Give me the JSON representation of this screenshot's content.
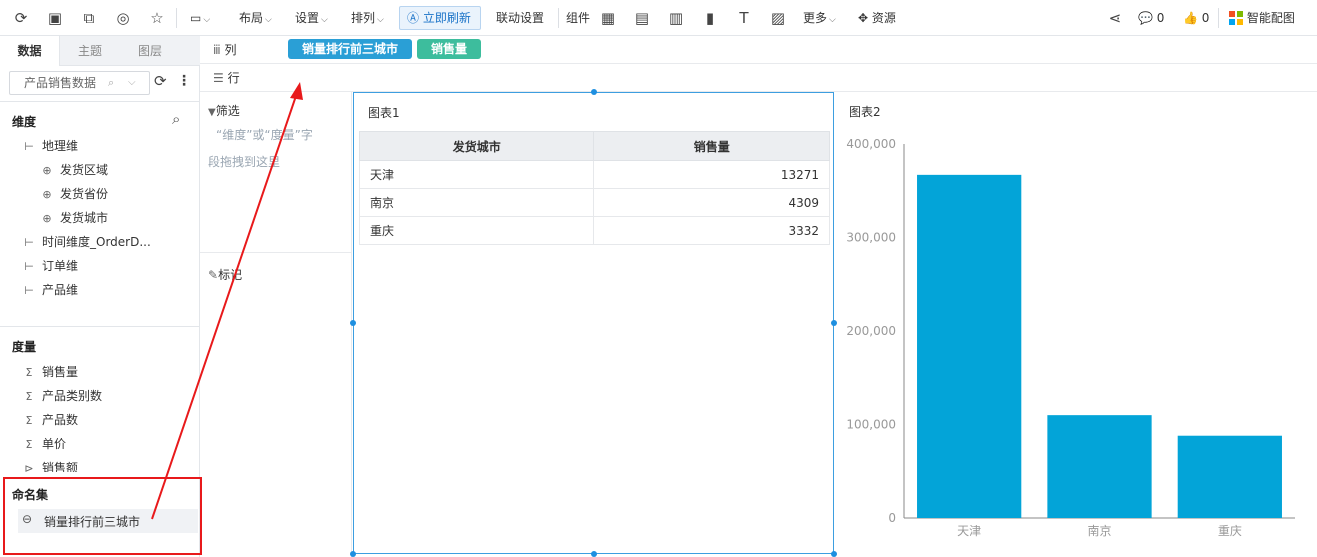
{
  "toolbar": {
    "layout": "布局",
    "settings": "设置",
    "arrange": "排列",
    "refresh": "立即刷新",
    "linkage": "联动设置",
    "components": "组件",
    "more": "更多",
    "resources": "资源",
    "comments_count": "0",
    "likes_count": "0",
    "smart_chart": "智能配图"
  },
  "left_tabs": [
    "数据",
    "主题",
    "图层"
  ],
  "dataset": "产品销售数据",
  "dimensions": {
    "title": "维度",
    "items": [
      {
        "label": "地理维",
        "level": 0,
        "icon": "hierarchy-icon"
      },
      {
        "label": "发货区域",
        "level": 1,
        "icon": "globe-icon"
      },
      {
        "label": "发货省份",
        "level": 1,
        "icon": "globe-icon"
      },
      {
        "label": "发货城市",
        "level": 1,
        "icon": "globe-icon"
      },
      {
        "label": "时间维度_OrderD...",
        "level": 0,
        "icon": "hierarchy-icon"
      },
      {
        "label": "订单维",
        "level": 0,
        "icon": "hierarchy-icon"
      },
      {
        "label": "产品维",
        "level": 0,
        "icon": "hierarchy-icon"
      }
    ]
  },
  "measures": {
    "title": "度量",
    "items": [
      "销售量",
      "产品类别数",
      "产品数",
      "单价",
      "销售额"
    ]
  },
  "named_sets": {
    "title": "命名集",
    "items": [
      "销量排行前三城市"
    ]
  },
  "shelf": {
    "columns_label": "列",
    "rows_label": "行",
    "pills": [
      {
        "label": "销量排行前三城市",
        "color": "#2a9fd6"
      },
      {
        "label": "销售量",
        "color": "#3dbd9d"
      }
    ]
  },
  "filter": {
    "title": "筛选",
    "hint_line1": "“维度”或“度量”字",
    "hint_line2": "段拖拽到这里",
    "mark_title": "标记"
  },
  "table_chart": {
    "title": "图表1",
    "headers": [
      "发货城市",
      "销售量"
    ],
    "rows": [
      {
        "city": "天津",
        "value": "13271"
      },
      {
        "city": "南京",
        "value": "4309"
      },
      {
        "city": "重庆",
        "value": "3332"
      }
    ]
  },
  "chart_data": {
    "type": "bar",
    "title": "图表2",
    "categories": [
      "天津",
      "南京",
      "重庆"
    ],
    "values": [
      367000,
      110000,
      88000
    ],
    "ylim": [
      0,
      400000
    ],
    "yticks": [
      "0",
      "100,000",
      "200,000",
      "300,000",
      "400,000"
    ],
    "bar_color": "#03a4d8",
    "grid": false
  },
  "colors": {
    "accent": "#1e8fe0",
    "annotation": "#e8191b"
  }
}
